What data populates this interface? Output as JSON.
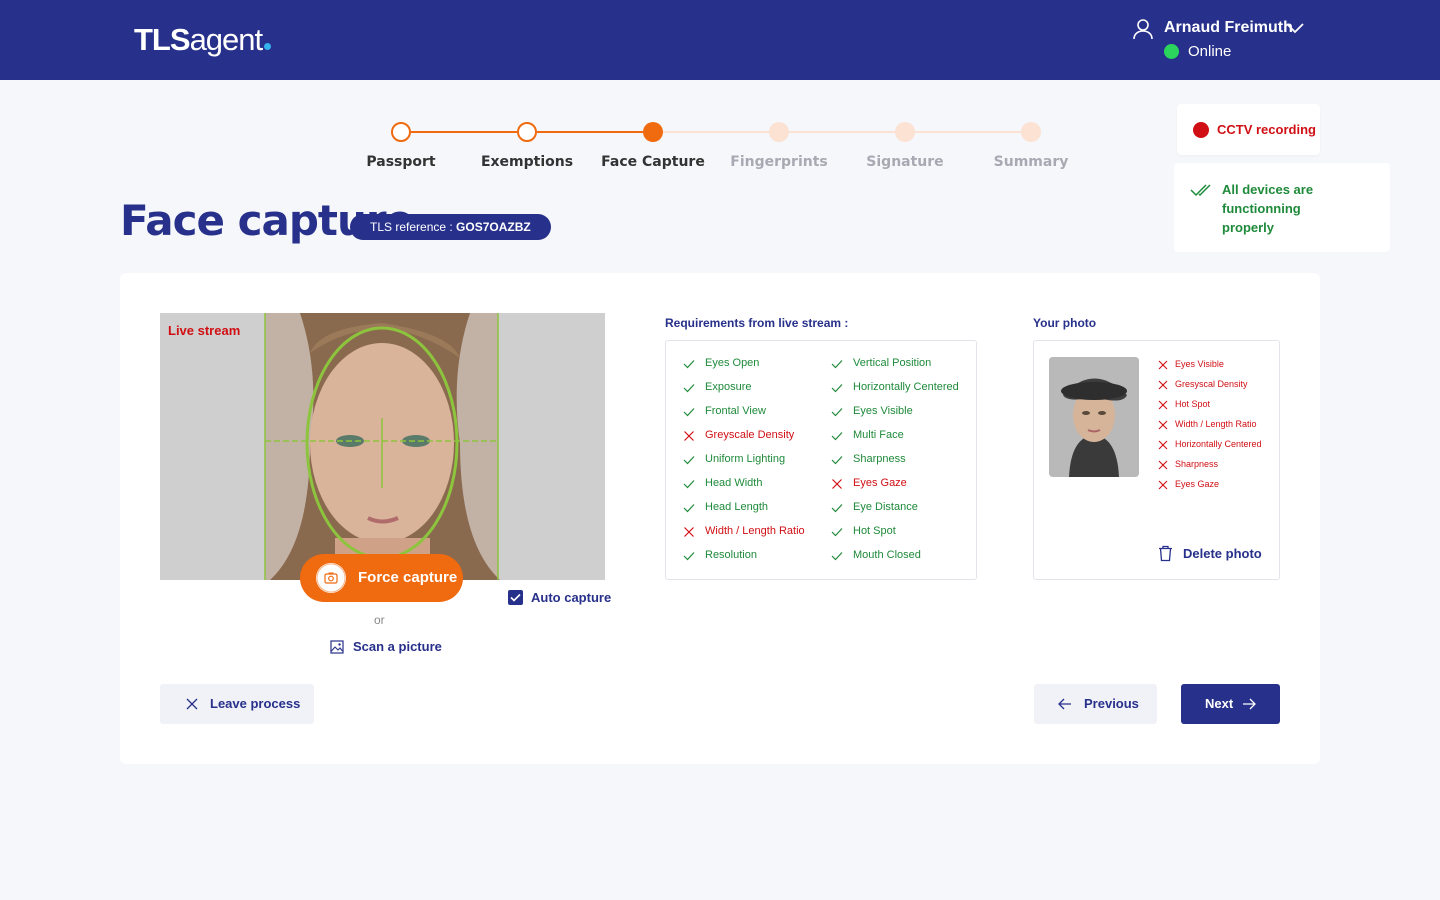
{
  "header": {
    "logo_bold": "TLS",
    "logo_rest": "agent",
    "user_name": "Arnaud Freimuth",
    "status": "Online",
    "bg_color": "#27308a",
    "status_color": "#2bd45c"
  },
  "stepper": {
    "steps": [
      {
        "label": "Passport",
        "state": "done"
      },
      {
        "label": "Exemptions",
        "state": "done"
      },
      {
        "label": "Face Capture",
        "state": "current"
      },
      {
        "label": "Fingerprints",
        "state": "pending"
      },
      {
        "label": "Signature",
        "state": "pending"
      },
      {
        "label": "Summary",
        "state": "pending"
      }
    ],
    "accent_color": "#f06a0f"
  },
  "notices": {
    "cctv": "CCTV recording",
    "devices": "All devices are functionning properly"
  },
  "page": {
    "title": "Face capture",
    "ref_prefix": "TLS reference : ",
    "ref_value": "GOS7OAZBZ"
  },
  "live": {
    "label": "Live stream",
    "force_capture": "Force capture",
    "auto_capture": "Auto capture",
    "auto_capture_checked": true,
    "or": "or",
    "scan": "Scan a picture"
  },
  "requirements": {
    "title": "Requirements from live stream :",
    "left": [
      {
        "label": "Eyes Open",
        "ok": true
      },
      {
        "label": "Exposure",
        "ok": true
      },
      {
        "label": "Frontal View",
        "ok": true
      },
      {
        "label": "Greyscale Density",
        "ok": false
      },
      {
        "label": "Uniform Lighting",
        "ok": true
      },
      {
        "label": "Head Width",
        "ok": true
      },
      {
        "label": "Head Length",
        "ok": true
      },
      {
        "label": "Width / Length Ratio",
        "ok": false
      },
      {
        "label": "Resolution",
        "ok": true
      }
    ],
    "right": [
      {
        "label": "Vertical Position",
        "ok": true
      },
      {
        "label": "Horizontally Centered",
        "ok": true
      },
      {
        "label": "Eyes Visible",
        "ok": true
      },
      {
        "label": "Multi Face",
        "ok": true
      },
      {
        "label": "Sharpness",
        "ok": true
      },
      {
        "label": "Eyes Gaze",
        "ok": false
      },
      {
        "label": "Eye Distance",
        "ok": true
      },
      {
        "label": "Hot Spot",
        "ok": true
      },
      {
        "label": "Mouth Closed",
        "ok": true
      }
    ]
  },
  "photo": {
    "title": "Your photo",
    "failures": [
      "Eyes Visible",
      "Gresyscal Density",
      "Hot Spot",
      "Width / Length Ratio",
      "Horizontally Centered",
      "Sharpness",
      "Eyes Gaze"
    ],
    "delete": "Delete photo"
  },
  "actions": {
    "leave": "Leave process",
    "previous": "Previous",
    "next": "Next"
  }
}
